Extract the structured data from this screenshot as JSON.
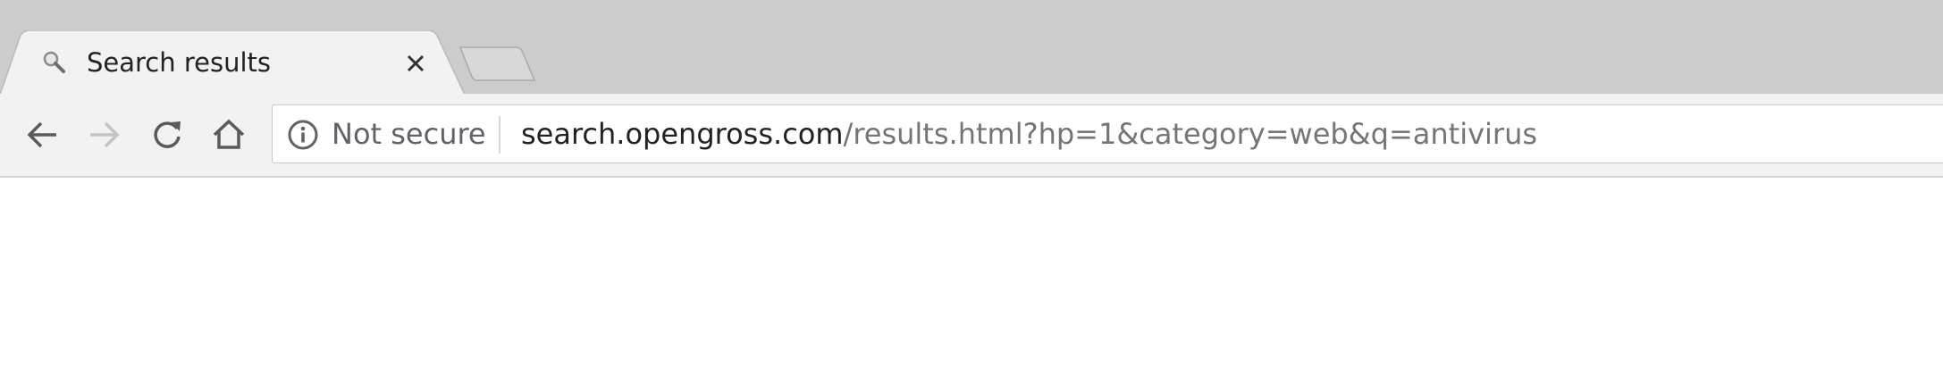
{
  "tab": {
    "title": "Search results",
    "favicon": "magnifier-icon",
    "close_icon": "close-icon"
  },
  "toolbar": {
    "back_icon": "arrow-left-icon",
    "forward_icon": "arrow-right-icon",
    "reload_icon": "reload-icon",
    "home_icon": "home-icon"
  },
  "omnibox": {
    "security_icon": "info-icon",
    "security_label": "Not secure",
    "url_host": "search.opengross.com",
    "url_path": "/results.html?hp=1&category=web&q=antivirus"
  },
  "colors": {
    "tab_strip": "#cccccc",
    "active_tab": "#f2f2f2",
    "toolbar": "#f2f2f2",
    "url_host": "#202124",
    "url_path": "#757575"
  }
}
